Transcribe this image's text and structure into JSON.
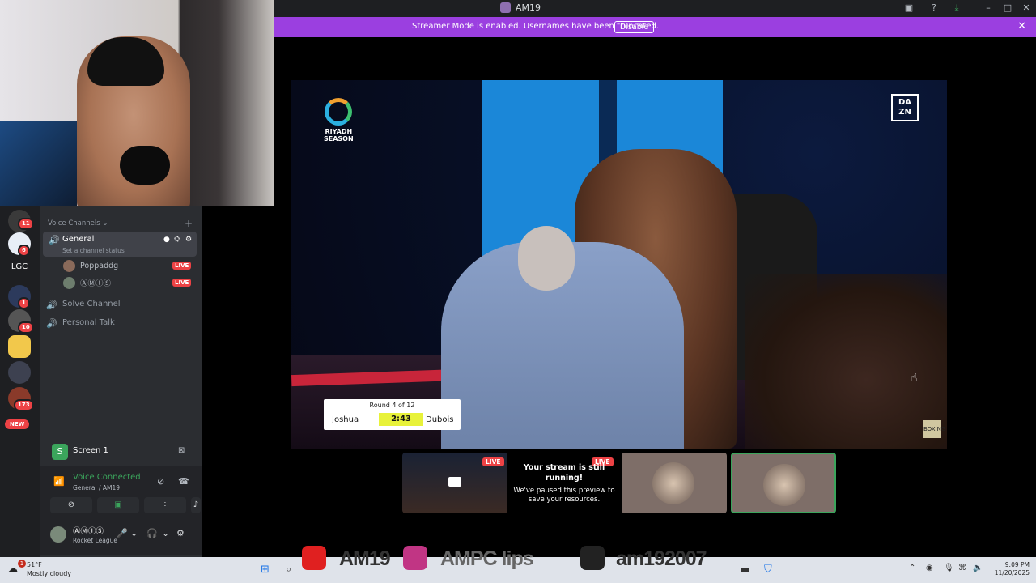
{
  "window": {
    "title": "AM19"
  },
  "banner": {
    "message": "Streamer Mode is enabled. Usernames have been truncated.",
    "button": "Disable"
  },
  "scoreboard": {
    "round": "Round 4 of 12",
    "fighter_a": "Joshua",
    "time": "2:43",
    "fighter_b": "Dubois"
  },
  "broadcast": {
    "logo_line1": "RIYADH",
    "logo_line2": "SEASON",
    "dazn_line1": "DA",
    "dazn_line2": "ZN",
    "corner": "BOXING"
  },
  "tiles": {
    "live_label": "LIVE",
    "paused_title": "Your stream is still running!",
    "paused_text": "We've paused this preview to save your resources."
  },
  "servers": {
    "badges": [
      "11",
      "6",
      "1",
      "10",
      "173"
    ],
    "lgc_label": "LGC",
    "new_label": "NEW"
  },
  "channels": {
    "header": "Voice Channels",
    "general": {
      "name": "General",
      "status": "Set a channel status"
    },
    "users": [
      {
        "name": "Poppaddg",
        "live": "LIVE"
      },
      {
        "name": "ⒶⓂⒾⓈ",
        "live": "LIVE"
      }
    ],
    "others": [
      "Solve Channel",
      "Personal Talk"
    ]
  },
  "screenshare": {
    "title": "Screen 1"
  },
  "voice": {
    "status": "Voice Connected",
    "location": "General / AM19"
  },
  "account": {
    "name": "ⒶⓂⒾⓈ",
    "activity": "Rocket League"
  },
  "taskbar": {
    "weather_temp": "51°F",
    "weather_desc": "Mostly cloudy",
    "weather_badge": "1",
    "time": "9:09 PM",
    "date": "11/20/2025",
    "overlay_name": "AM19",
    "overlay_clips": "AMPC lips",
    "overlay_tiktok": "am192007"
  },
  "colors": {
    "banner": "#9b3fe0",
    "live": "#ed4245",
    "connected": "#3ba55c"
  }
}
